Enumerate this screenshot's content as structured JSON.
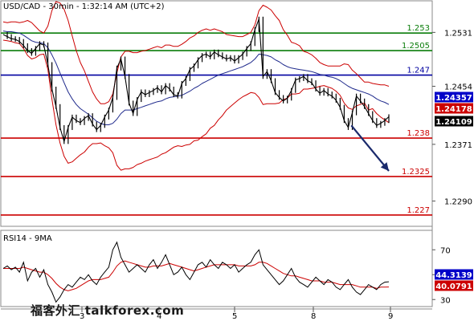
{
  "header": {
    "symbol_info": "USD/CAD - 30min - 1:32:14 AM (UTC+2)"
  },
  "rsi_panel": {
    "label": "RSI14 - 9MA"
  },
  "watermark": {
    "text": "福客外汇 talkforex.com"
  },
  "colors": {
    "price": "#000000",
    "bollinger": "#cc0000",
    "moving_avg": "#1f2a8c",
    "resistance": "#0a7d0a",
    "pivot": "#0000a0",
    "support": "#cc0000",
    "arrow": "#1a2a6c",
    "rsi": "#000000",
    "rsi_ma": "#cc0000"
  },
  "chart_data": [
    {
      "type": "line",
      "title": "USD/CAD - 30min - 1:32:14 AM (UTC+2)",
      "ylim": [
        1.2255,
        1.2575
      ],
      "y_ticks": [
        1.2531,
        1.2454,
        1.2371,
        1.229
      ],
      "x_ticks": [
        "3",
        "4",
        "5",
        "8",
        "9"
      ],
      "levels": [
        {
          "value": 1.253,
          "label": "1.253",
          "kind": "resistance"
        },
        {
          "value": 1.2505,
          "label": "1.2505",
          "kind": "resistance"
        },
        {
          "value": 1.247,
          "label": "1.247",
          "kind": "pivot"
        },
        {
          "value": 1.238,
          "label": "1.238",
          "kind": "support"
        },
        {
          "value": 1.2325,
          "label": "1.2325",
          "kind": "support"
        },
        {
          "value": 1.227,
          "label": "1.227",
          "kind": "support"
        }
      ],
      "price_tags": [
        {
          "value": 1.24357,
          "label": "1.24357",
          "style": "blue"
        },
        {
          "value": 1.24178,
          "label": "1.24178",
          "style": "red"
        },
        {
          "value": 1.24109,
          "label": "1.24109",
          "style": "black"
        }
      ],
      "arrow": {
        "from": [
          102,
          1.2398
        ],
        "to": [
          113,
          1.2333
        ]
      },
      "series": [
        {
          "values": [
            1.2528,
            1.2525,
            1.2522,
            1.2521,
            1.2518,
            1.2512,
            1.2505,
            1.2501,
            1.2508,
            1.2515,
            1.2513,
            1.2485,
            1.245,
            1.2425,
            1.2395,
            1.2375,
            1.2395,
            1.241,
            1.2405,
            1.2402,
            1.2408,
            1.2412,
            1.24,
            1.2392,
            1.2398,
            1.241,
            1.242,
            1.2438,
            1.248,
            1.2493,
            1.2468,
            1.243,
            1.2415,
            1.2435,
            1.2446,
            1.2442,
            1.2445,
            1.2448,
            1.2452,
            1.2446,
            1.2455,
            1.245,
            1.2442,
            1.244,
            1.2458,
            1.2465,
            1.2478,
            1.2483,
            1.2492,
            1.2498,
            1.25,
            1.2496,
            1.2503,
            1.2499,
            1.2496,
            1.2493,
            1.2495,
            1.249,
            1.2495,
            1.25,
            1.2508,
            1.2515,
            1.2535,
            1.255,
            1.2468,
            1.2475,
            1.2462,
            1.2445,
            1.2438,
            1.2433,
            1.2437,
            1.2448,
            1.2463,
            1.2465,
            1.2468,
            1.2462,
            1.2459,
            1.245,
            1.2444,
            1.2448,
            1.2443,
            1.244,
            1.2434,
            1.2424,
            1.2405,
            1.2395,
            1.2416,
            1.244,
            1.2433,
            1.2425,
            1.2415,
            1.2405,
            1.2398,
            1.2401,
            1.2405,
            1.24105
          ]
        },
        {
          "values": [
            1.2533,
            1.2532,
            1.2532,
            1.2531,
            1.253,
            1.2527,
            1.2523,
            1.2519,
            1.2517,
            1.2516,
            1.2515,
            1.2509,
            1.2499,
            1.2487,
            1.2473,
            1.2459,
            1.2446,
            1.2436,
            1.2428,
            1.2422,
            1.2418,
            1.2414,
            1.2409,
            1.2404,
            1.2401,
            1.2399,
            1.2399,
            1.2401,
            1.2407,
            1.2415,
            1.242,
            1.242,
            1.242,
            1.2422,
            1.2424,
            1.2426,
            1.2428,
            1.243,
            1.2432,
            1.2433,
            1.2436,
            1.2438,
            1.2439,
            1.244,
            1.2441,
            1.2444,
            1.2447,
            1.2451,
            1.2454,
            1.2458,
            1.2461,
            1.2464,
            1.2467,
            1.247,
            1.2472,
            1.2474,
            1.2476,
            1.2478,
            1.248,
            1.2482,
            1.2485,
            1.2488,
            1.2493,
            1.25,
            1.2499,
            1.2498,
            1.2496,
            1.2492,
            1.2489,
            1.2485,
            1.2482,
            1.248,
            1.2479,
            1.2478,
            1.2477,
            1.2476,
            1.2475,
            1.2473,
            1.2471,
            1.247,
            1.2468,
            1.2467,
            1.2465,
            1.2462,
            1.2458,
            1.2454,
            1.2451,
            1.2449,
            1.2447,
            1.2445,
            1.2443,
            1.244,
            1.2436,
            1.2433,
            1.2431,
            1.2428
          ]
        },
        {
          "values": [
            1.2546,
            1.2545,
            1.2546,
            1.2546,
            1.2545,
            1.2546,
            1.2548,
            1.2545,
            1.2539,
            1.2533,
            1.253,
            1.254,
            1.2562,
            1.2575,
            1.2573,
            1.2564,
            1.2548,
            1.2526,
            1.2505,
            1.2488,
            1.2476,
            1.2461,
            1.2446,
            1.2436,
            1.2429,
            1.2429,
            1.2432,
            1.2443,
            1.2473,
            1.2496,
            1.2504,
            1.2504,
            1.2502,
            1.2502,
            1.2504,
            1.2505,
            1.2507,
            1.2509,
            1.2511,
            1.2509,
            1.2513,
            1.2513,
            1.2511,
            1.2511,
            1.2514,
            1.2518,
            1.2523,
            1.2526,
            1.2531,
            1.2534,
            1.2536,
            1.2534,
            1.2536,
            1.2534,
            1.2532,
            1.2528,
            1.2527,
            1.2526,
            1.2525,
            1.2525,
            1.2528,
            1.2531,
            1.2542,
            1.2562,
            1.257,
            1.2567,
            1.2563,
            1.2555,
            1.2548,
            1.2535,
            1.2527,
            1.2517,
            1.2515,
            1.2512,
            1.2504,
            1.2502,
            1.2499,
            1.2494,
            1.2488,
            1.2485,
            1.2483,
            1.2483,
            1.2483,
            1.2483,
            1.2486,
            1.2485,
            1.2477,
            1.2472,
            1.2466,
            1.246,
            1.246,
            1.2458,
            1.2457,
            1.2456,
            1.2456,
            1.2454
          ]
        },
        {
          "values": [
            1.252,
            1.2519,
            1.2518,
            1.2516,
            1.2515,
            1.2508,
            1.2498,
            1.2493,
            1.2495,
            1.2499,
            1.25,
            1.2478,
            1.2436,
            1.2399,
            1.2373,
            1.2354,
            1.2344,
            1.2346,
            1.2351,
            1.2356,
            1.236,
            1.2367,
            1.2372,
            1.2372,
            1.2373,
            1.2369,
            1.2366,
            1.2359,
            1.2341,
            1.2334,
            1.2336,
            1.2336,
            1.2338,
            1.2342,
            1.2344,
            1.2347,
            1.2349,
            1.2351,
            1.2353,
            1.2357,
            1.2359,
            1.2363,
            1.2367,
            1.2369,
            1.2368,
            1.237,
            1.2371,
            1.2376,
            1.2377,
            1.2382,
            1.2386,
            1.2394,
            1.2398,
            1.2406,
            1.2412,
            1.242,
            1.2425,
            1.243,
            1.2435,
            1.2439,
            1.2442,
            1.2445,
            1.2444,
            1.2438,
            1.2428,
            1.2429,
            1.2429,
            1.2429,
            1.243,
            1.2435,
            1.2437,
            1.2443,
            1.2443,
            1.2444,
            1.245,
            1.245,
            1.2451,
            1.2452,
            1.2454,
            1.2455,
            1.2453,
            1.2451,
            1.2447,
            1.2441,
            1.243,
            1.2423,
            1.2421,
            1.2426,
            1.2428,
            1.243,
            1.242,
            1.2422,
            1.2415,
            1.241,
            1.2406,
            1.2402
          ]
        }
      ]
    },
    {
      "type": "line",
      "title": "RSI14 - 9MA",
      "ylim": [
        25,
        85
      ],
      "y_ticks": [
        70,
        50,
        30
      ],
      "x_ticks": [
        "3",
        "4",
        "5",
        "8",
        "9"
      ],
      "price_tags": [
        {
          "value": 44.3139,
          "label": "44.3139",
          "style": "blue"
        },
        {
          "value": 40.0791,
          "label": "40.0791",
          "style": "red"
        }
      ],
      "series": [
        {
          "values": [
            55,
            57,
            54,
            56,
            52,
            60,
            45,
            52,
            55,
            48,
            54,
            42,
            36,
            28,
            32,
            38,
            42,
            40,
            44,
            48,
            46,
            50,
            45,
            42,
            48,
            52,
            56,
            70,
            76,
            64,
            58,
            52,
            55,
            58,
            55,
            52,
            58,
            62,
            55,
            60,
            66,
            58,
            50,
            52,
            56,
            50,
            46,
            52,
            58,
            60,
            56,
            62,
            58,
            55,
            60,
            58,
            55,
            58,
            52,
            55,
            58,
            60,
            66,
            70,
            58,
            54,
            50,
            46,
            42,
            45,
            50,
            55,
            48,
            44,
            42,
            40,
            44,
            48,
            45,
            42,
            46,
            44,
            40,
            38,
            42,
            46,
            40,
            36,
            34,
            38,
            42,
            40,
            38,
            42,
            44,
            44.3
          ]
        },
        {
          "values": [
            55,
            55,
            55,
            55,
            55,
            56,
            55,
            54,
            53,
            52,
            52,
            50,
            47,
            43,
            40,
            38,
            37,
            38,
            39,
            41,
            43,
            45,
            46,
            46,
            46,
            47,
            48,
            52,
            57,
            60,
            61,
            60,
            59,
            58,
            57,
            56,
            56,
            57,
            57,
            57,
            58,
            59,
            58,
            57,
            56,
            55,
            54,
            53,
            54,
            55,
            56,
            57,
            58,
            58,
            58,
            58,
            58,
            58,
            57,
            57,
            57,
            57,
            58,
            60,
            60,
            59,
            57,
            55,
            53,
            51,
            50,
            49,
            49,
            48,
            47,
            46,
            45,
            45,
            45,
            44,
            44,
            44,
            43,
            42,
            42,
            42,
            42,
            41,
            40,
            40,
            40,
            40,
            39,
            40,
            40,
            40.1
          ]
        }
      ]
    }
  ]
}
